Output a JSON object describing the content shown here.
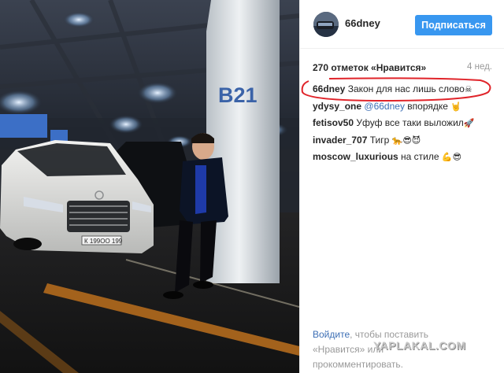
{
  "post": {
    "username": "66dney",
    "follow_label": "Подписаться",
    "likes": "270 отметок «Нравится»",
    "age": "4 нед.",
    "parking_label": "B21",
    "plate_text": "К 199ОО 199"
  },
  "comments": [
    {
      "user": "66dney",
      "text": "Закон для нас лишь слово",
      "emoji": "☠"
    },
    {
      "user": "ydysy_one",
      "mention": "@66dney",
      "text": "впорядке",
      "emoji": "🤘"
    },
    {
      "user": "fetisov50",
      "text": "Уфуф все таки выложил",
      "emoji": "🚀"
    },
    {
      "user": "invader_707",
      "text": "Тигр",
      "emoji": "🐆😎😈"
    },
    {
      "user": "moscow_luxurious",
      "text": "на стиле",
      "emoji": "💪😎"
    }
  ],
  "login": {
    "link": "Войдите",
    "rest1": ", чтобы поставить",
    "rest2": "«Нравится» или",
    "rest3": "прокомментировать."
  },
  "watermark": "YAPLAKAL.COM",
  "colors": {
    "accent": "#3897f0",
    "highlight": "#e0242a",
    "link": "#3d6fb5"
  }
}
